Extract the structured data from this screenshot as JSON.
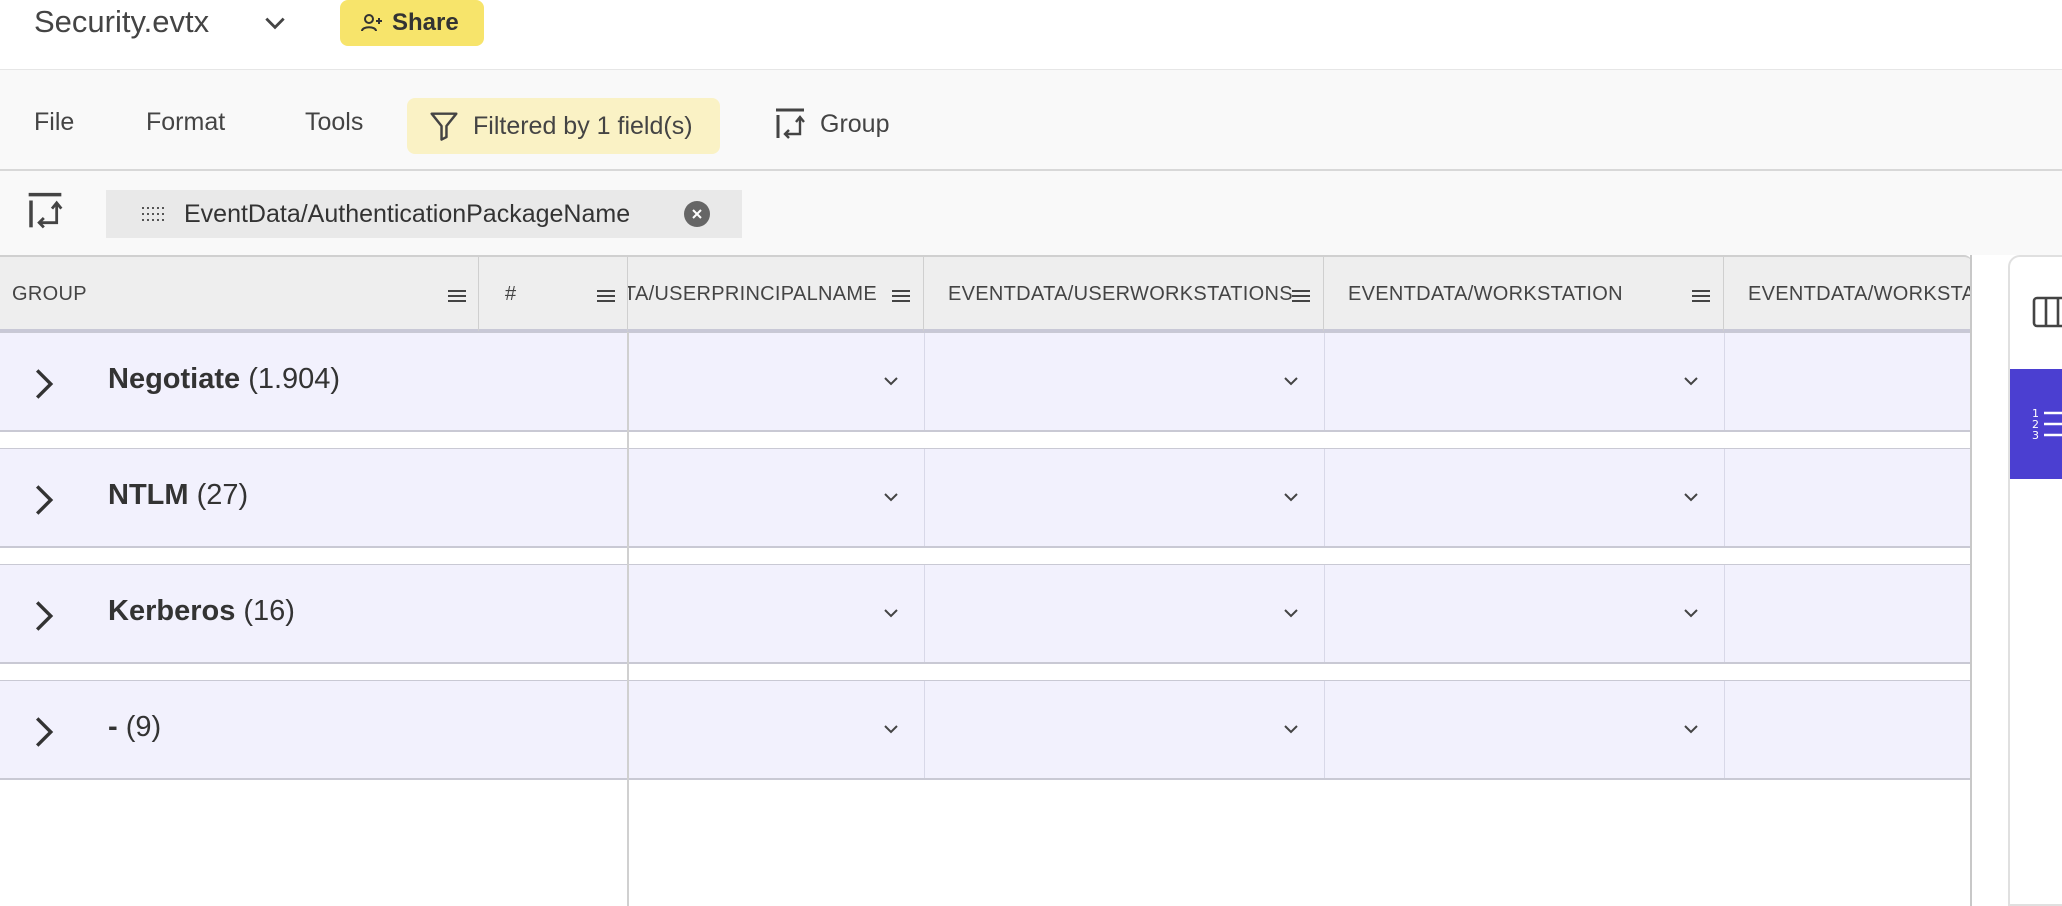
{
  "topbar": {
    "file_title": "Security.evtx",
    "share_label": "Share"
  },
  "menubar": {
    "file": "File",
    "format": "Format",
    "tools": "Tools",
    "filter_label": "Filtered by 1 field(s)",
    "group_label": "Group"
  },
  "groupbar": {
    "chip_label": "EventData/AuthenticationPackageName"
  },
  "grid": {
    "headers": {
      "group": "GROUP",
      "index": "#",
      "userprincipalname": "EVENTDATA/USERPRINCIPALNAME",
      "userworkstations": "EVENTDATA/USERWORKSTATIONS",
      "workstation": "EVENTDATA/WORKSTATION",
      "workstationname": "EVENTDATA/WORKSTATIONNAME"
    },
    "groups": [
      {
        "name": "Negotiate",
        "count": "(1.904)"
      },
      {
        "name": "NTLM",
        "count": "(27)"
      },
      {
        "name": "Kerberos",
        "count": "(16)"
      },
      {
        "name": "-",
        "count": "(9)"
      }
    ]
  },
  "colors": {
    "accent": "#4b3fd1",
    "share": "#f7e46b",
    "filter_chip": "#faf2c5",
    "group_row": "#f2f1fd"
  },
  "icons": {
    "title_dropdown": "chevron-down-icon",
    "share": "person-add-icon",
    "filter": "funnel-icon",
    "group": "group-by-icon",
    "chip_drag": "drag-handle-icon",
    "chip_remove": "close-circle-icon",
    "column_menu": "hamburger-menu-icon",
    "row_expand": "chevron-right-icon",
    "side_columns": "columns-icon",
    "side_numbered": "numbered-list-icon"
  }
}
